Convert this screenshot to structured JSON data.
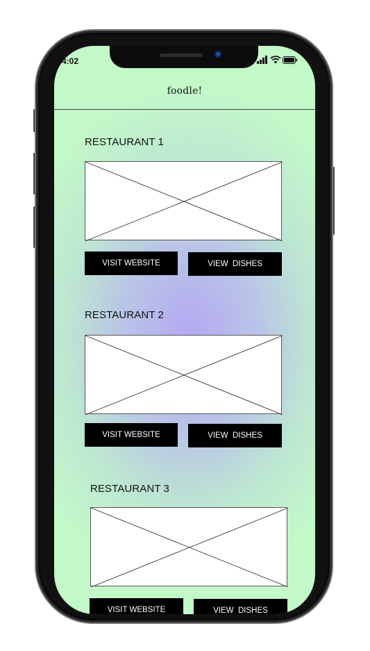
{
  "status_bar": {
    "time": "4:02",
    "icons": [
      "signal-icon",
      "wifi-icon",
      "battery-icon"
    ]
  },
  "header": {
    "title": "foodle!"
  },
  "restaurants": [
    {
      "name": "RESTAURANT 1",
      "visit_label": "VISIT WEBSITE",
      "dishes_label": "VIEW  DISHES"
    },
    {
      "name": "RESTAURANT 2",
      "visit_label": "VISIT WEBSITE",
      "dishes_label": "VIEW  DISHES"
    },
    {
      "name": "RESTAURANT 3",
      "visit_label": "VISIT WEBSITE",
      "dishes_label": "VIEW  DISHES"
    }
  ],
  "colors": {
    "background_outer": "#c3f8c9",
    "background_center": "#b4a8f4",
    "button_bg": "#000000",
    "button_text": "#ffffff"
  }
}
